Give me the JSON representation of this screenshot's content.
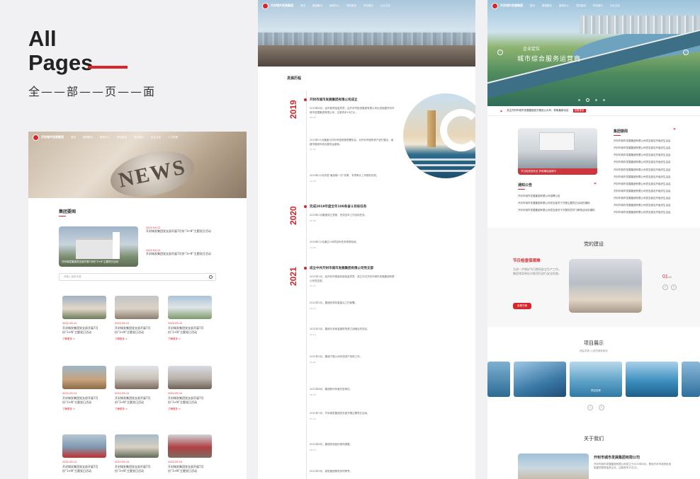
{
  "title": {
    "line1": "All",
    "line2": "Pages",
    "subtitle": "全——部——页——面"
  },
  "nav": {
    "logo_text": "开封城市发展集团",
    "items": [
      "首页",
      "集团概况",
      "新闻中心",
      "党的建设",
      "项目展示",
      "企业文化",
      "人力资源",
      "联系我们"
    ]
  },
  "news_page": {
    "hero_word": "NEWS",
    "section_title": "集团要闻",
    "feature_caption": "开封城发集团党支部开展7月份“3+N”主题党日活动",
    "side_news": [
      {
        "date": "2022-09-12",
        "title": "开封城发集团党支部开展7月份“3+N”主题党日活动"
      },
      {
        "date": "2022-09-12",
        "title": "开封城发集团党支部开展7月份“3+N”主题党日活动"
      }
    ],
    "search_placeholder": "请输入搜索关键",
    "cards": [
      {
        "date": "2022-09-12",
        "title": "开封城发集团党支部开展7月份“3+N”主题党日活动",
        "more": "了解更多 >"
      },
      {
        "date": "2022-09-12",
        "title": "开封城发集团党支部开展7月份“3+N”主题党日活动",
        "more": "了解更多 >"
      },
      {
        "date": "2022-09-12",
        "title": "开封城发集团党支部开展7月份“3+N”主题党日活动",
        "more": "了解更多 >"
      },
      {
        "date": "2022-09-12",
        "title": "开封城发集团党支部开展7月份“3+N”主题党日活动",
        "more": "了解更多 >"
      },
      {
        "date": "2022-09-12",
        "title": "开封城发集团党支部开展7月份“3+N”主题党日活动",
        "more": "了解更多 >"
      },
      {
        "date": "2022-09-12",
        "title": "开封城发集团党支部开展7月份“3+N”主题党日活动",
        "more": "了解更多 >"
      },
      {
        "date": "2022-09-12",
        "title": "开封城发集团党支部开展7月份“3+N”主题党日活动",
        "more": ""
      },
      {
        "date": "2022-09-12",
        "title": "开封城发集团党支部开展7月份“3+N”主题党日活动",
        "more": ""
      },
      {
        "date": "2022-09-12",
        "title": "开封城发集团党支部开展7月份“3+N”主题党日活动",
        "more": ""
      }
    ]
  },
  "history_page": {
    "heading": "发展历程",
    "years": [
      {
        "year": "2019",
        "title": "开封市城市发展集团有限公司成立",
        "events": [
          {
            "text": "2019年8月，经市政府批复同意，由开封市投资集团有限公司出资组建开封市城市发展集团有限公司，注册资本10亿元。",
            "date": "08-08"
          },
          {
            "text": "2019年11月集团与开封市国资委签署协议，对开封市国有资产进行整合，组建市属城市综合服务运营商。",
            "date": "11-03"
          },
          {
            "text": "2019年12月完成“最多跑一次”改革，专项审计工作顺利完成。",
            "date": "12-03"
          }
        ]
      },
      {
        "year": "2020",
        "title": "完成2019年度全年108条奋斗目标任务",
        "events": [
          {
            "text": "2020年1月集团成立党委，完成全年工作目标任务。",
            "date": "01-08"
          },
          {
            "text": "2020年12月通过108项目标任务考核验收。",
            "date": "12-05"
          }
        ]
      },
      {
        "year": "2021",
        "title": "成立中共开封市城市发展集团有限公司党支部",
        "events": [
          {
            "text": "2021年1月，经开封市委组织部批复同意，成立中共开封市城市发展集团有限公司党支部。",
            "date": "01-01"
          },
          {
            "text": "2021年2月，集团完成年度重点工作部署。",
            "date": "02-12"
          },
          {
            "text": "2021年3月，集团与多家金融机构签订战略合作协议。",
            "date": "03-10"
          },
          {
            "text": "2021年5月，集团下属公司完成资产划转工作。",
            "date": "05-06"
          },
          {
            "text": "2021年6月，集团获评年度先进单位。",
            "date": "06-18"
          },
          {
            "text": "2021年7月，开封城发集团党支部开展主题党日活动。",
            "date": "07-20"
          },
          {
            "text": "2021年8月，集团完成组织架构调整。",
            "date": "08-15"
          },
          {
            "text": "2021年9月，城发集团荣获多项荣誉。",
            "date": ""
          }
        ]
      }
    ]
  },
  "home_page": {
    "hero_small": "企业定位",
    "hero_big": "城市综合服务运营商",
    "notice": "关注开封市城市发展集团官方微信公众号，获取最新动态",
    "notice_tag": "查看更多",
    "group_news_title": "集团要闻",
    "feature_caption": "节日检查保安全 护航确保疫情平",
    "notice_title": "通知公告",
    "notices": [
      "开封市城市发展集团有限公司招聘公告",
      "开封市城市发展集团有限公司党支部关于开展主题党日活动的通知",
      "开封市城市发展集团有限公司党支部关于开展党员学习教育活动的通知"
    ],
    "news_list": [
      "开封市城市发展集团有限公司党支部召开组织生活会",
      "开封市城市发展集团有限公司党支部召开组织生活会",
      "开封市城市发展集团有限公司党支部召开组织生活会",
      "开封市城市发展集团有限公司党支部召开组织生活会",
      "开封市城市发展集团有限公司党支部召开组织生活会",
      "开封市城市发展集团有限公司党支部召开组织生活会",
      "开封市城市发展集团有限公司党支部召开组织生活会",
      "开封市城市发展集团有限公司党支部召开组织生活会",
      "开封市城市发展集团有限公司党支部召开组织生活会",
      "开封市城市发展集团有限公司党支部召开组织生活会",
      "开封市城市发展集团有限公司党支部召开组织生活会"
    ],
    "party_title": "党的建设",
    "party_heading": "节日检查保艰难",
    "party_text": "为进一步做好节日期间安全生产工作，集团领导带队对各项目进行安全检查。",
    "party_button": "查看详情",
    "party_count": "01",
    "party_total": "/05",
    "project_title": "项目展示",
    "project_sub": "精益求精 以品质铸就精品",
    "project_card_caption": "项目名称",
    "about_title": "关于我们",
    "about_heading": "开封市城市发展集团有限公司",
    "about_text": "开封市城市发展集团有限公司成立于2019年8月，是经开封市政府批准组建的国有独资企业，注册资本10亿元。"
  }
}
